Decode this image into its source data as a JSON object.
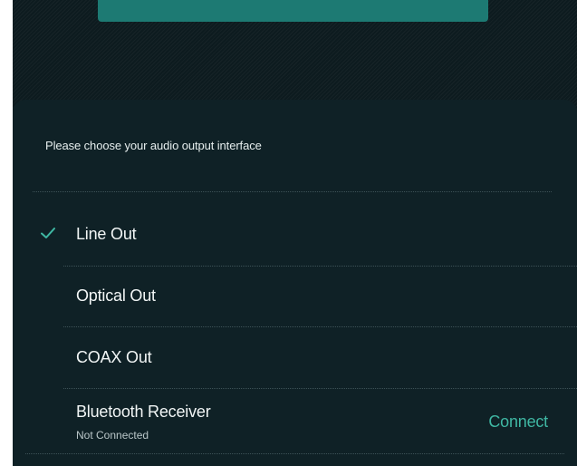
{
  "header": {
    "prompt": "Please choose your audio output interface"
  },
  "options": [
    {
      "label": "Line Out",
      "selected": true
    },
    {
      "label": "Optical Out",
      "selected": false
    },
    {
      "label": "COAX Out",
      "selected": false
    },
    {
      "label": "Bluetooth Receiver",
      "status": "Not Connected",
      "action_label": "Connect",
      "selected": false
    }
  ],
  "colors": {
    "background": "#0d1b1f",
    "sheet": "#0f2126",
    "accent": "#3fb7a3",
    "top_button": "#1d7a73"
  },
  "icons": {
    "selected_indicator": "check-icon"
  }
}
